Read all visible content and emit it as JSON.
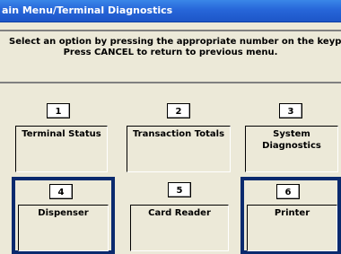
{
  "window": {
    "title": "ain Menu/Terminal Diagnostics"
  },
  "instructions": {
    "line1": "Select an option by pressing the appropriate number on the keypad",
    "line2": "Press CANCEL to return to previous menu."
  },
  "options": [
    {
      "number": "1",
      "label": "Terminal Status"
    },
    {
      "number": "2",
      "label": "Transaction Totals"
    },
    {
      "number": "3",
      "label_line1": "System",
      "label_line2": "Diagnostics"
    },
    {
      "number": "4",
      "label": "Dispenser",
      "highlighted": true
    },
    {
      "number": "5",
      "label": "Card Reader"
    },
    {
      "number": "6",
      "label": "Printer",
      "highlighted": true
    }
  ],
  "colors": {
    "titlebar": "#2766d9",
    "background": "#ece9d8",
    "highlight": "#0a2a6e"
  }
}
